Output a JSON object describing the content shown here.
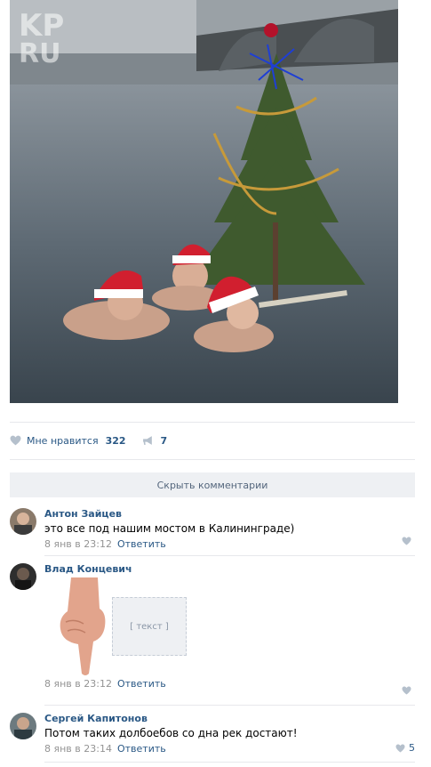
{
  "post": {
    "photo_icon": "santa-hat-swimmers-with-christmas-tree",
    "likes": {
      "label": "Мне нравится",
      "count": "322"
    },
    "shares": {
      "count": "7"
    }
  },
  "hide_comments_label": "Скрыть комментарии",
  "comments": [
    {
      "author": "Антон Зайцев",
      "text": "это все под нашим мостом в Калининграде)",
      "time": "8 янв в 23:12",
      "reply": "Ответить",
      "likes": ""
    },
    {
      "author": "Влад Концевич",
      "text": "",
      "time": "8 янв в 23:12",
      "reply": "Ответить",
      "likes": ""
    },
    {
      "author": "Сергей Капитонов",
      "text": "Потом таких долбоебов со дна рек достают!",
      "time": "8 янв в 23:14",
      "reply": "Ответить",
      "likes": "5"
    }
  ],
  "colors": {
    "link": "#2a5885",
    "muted": "#939393",
    "button_bg": "#eef0f3"
  }
}
